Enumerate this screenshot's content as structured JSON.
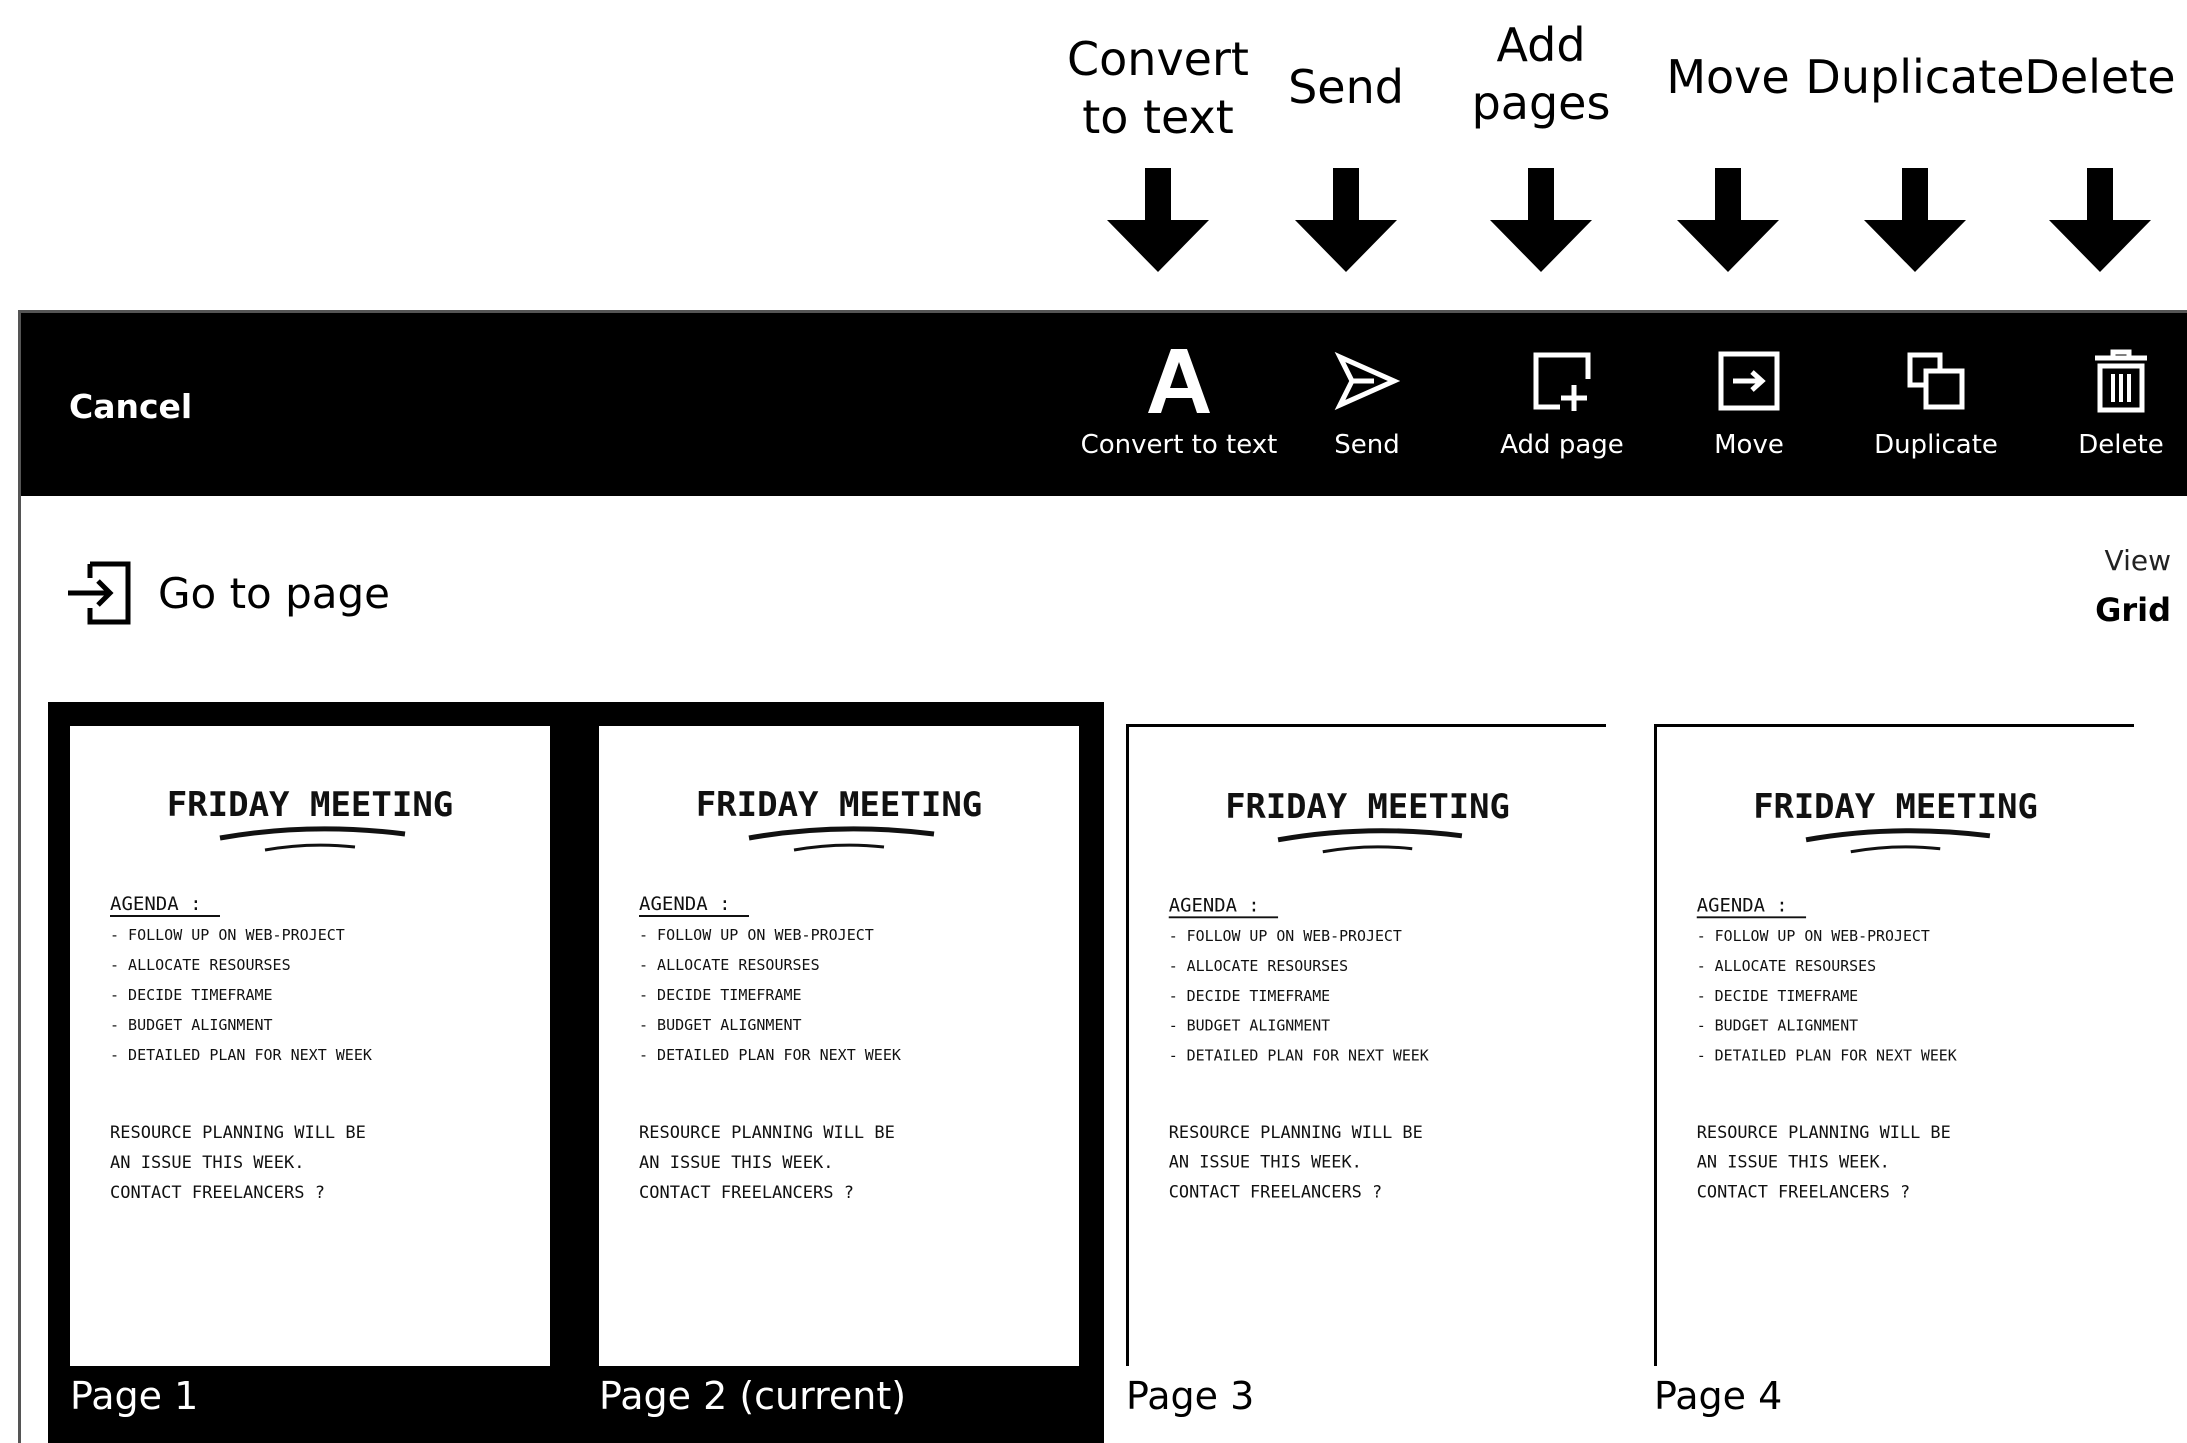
{
  "callouts": [
    {
      "label": "Convert\nto text",
      "icon": "down-arrow-icon"
    },
    {
      "label": "Send",
      "icon": "down-arrow-icon"
    },
    {
      "label": "Add\npages",
      "icon": "down-arrow-icon"
    },
    {
      "label": "Move",
      "icon": "down-arrow-icon"
    },
    {
      "label": "Duplicate",
      "icon": "down-arrow-icon"
    },
    {
      "label": "Delete",
      "icon": "down-arrow-icon"
    }
  ],
  "toolbar": {
    "cancel_label": "Cancel",
    "tools": [
      {
        "label": "Convert to text",
        "icon": "text-a-icon"
      },
      {
        "label": "Send",
        "icon": "send-icon"
      },
      {
        "label": "Add page",
        "icon": "add-page-icon"
      },
      {
        "label": "Move",
        "icon": "move-icon"
      },
      {
        "label": "Duplicate",
        "icon": "duplicate-icon"
      },
      {
        "label": "Delete",
        "icon": "trash-icon"
      }
    ]
  },
  "goto": {
    "label": "Go to page",
    "icon": "goto-page-icon"
  },
  "view": {
    "label": "View",
    "value": "Grid"
  },
  "pages": [
    {
      "label": "Page 1",
      "selected": true
    },
    {
      "label": "Page 2 (current)",
      "selected": true
    },
    {
      "label": "Page 3",
      "selected": false
    },
    {
      "label": "Page 4",
      "selected": false
    }
  ],
  "note": {
    "title": "FRIDAY MEETING",
    "agenda_heading": "AGENDA :",
    "agenda_items": [
      "- FOLLOW UP ON WEB-PROJECT",
      "- ALLOCATE RESOURSES",
      "- DECIDE TIMEFRAME",
      "- BUDGET ALIGNMENT",
      "- DETAILED PLAN FOR NEXT WEEK"
    ],
    "body_lines": [
      "RESOURCE PLANNING WILL BE",
      "AN ISSUE THIS WEEK.",
      "CONTACT FREELANCERS ?"
    ]
  }
}
